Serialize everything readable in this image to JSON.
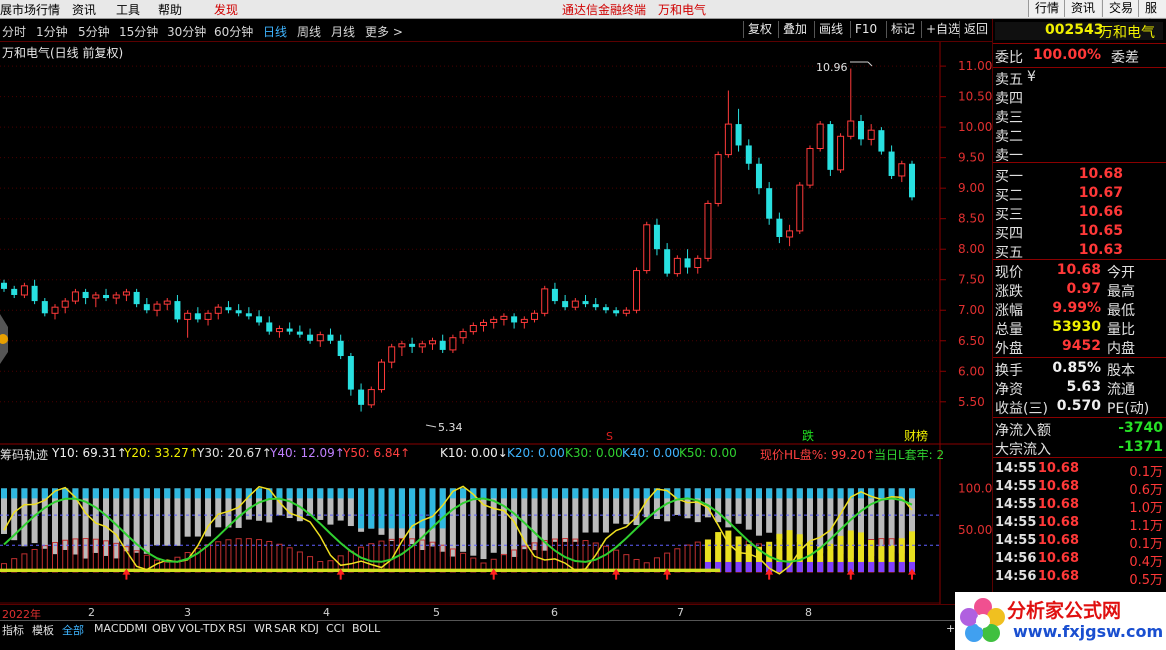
{
  "menu": {
    "items": [
      "展市场行情",
      "资讯",
      "工具",
      "帮助"
    ],
    "discover": "发现",
    "center_title": "通达信金融终端",
    "center_stock": "万和电气",
    "right_buttons": [
      "行情",
      "资讯",
      "交易",
      "服务"
    ]
  },
  "periods": [
    "分时",
    "1分钟",
    "5分钟",
    "15分钟",
    "30分钟",
    "60分钟",
    "日线",
    "周线",
    "月线",
    "更多 >"
  ],
  "active_period": "日线",
  "toolbar": [
    "复权",
    "叠加",
    "画线",
    "F10",
    "标记",
    "+自选",
    "返回"
  ],
  "stock_title": "万和电气(日线 前复权)",
  "quote": {
    "code": "002543",
    "name": "万和电气",
    "weibi_label": "委比",
    "weibi_value": "100.00%",
    "weicha_label": "委差",
    "sells": [
      {
        "label": "卖五",
        "price": "¥"
      },
      {
        "label": "卖四",
        "price": ""
      },
      {
        "label": "卖三",
        "price": ""
      },
      {
        "label": "卖二",
        "price": ""
      },
      {
        "label": "卖一",
        "price": ""
      }
    ],
    "buys": [
      {
        "label": "买一",
        "price": "10.68"
      },
      {
        "label": "买二",
        "price": "10.67"
      },
      {
        "label": "买三",
        "price": "10.66"
      },
      {
        "label": "买四",
        "price": "10.65"
      },
      {
        "label": "买五",
        "price": "10.63"
      }
    ],
    "stats": [
      {
        "l1": "现价",
        "v1": "10.68",
        "c1": "red",
        "l2": "今开"
      },
      {
        "l1": "涨跌",
        "v1": "0.97",
        "c1": "red",
        "l2": "最高"
      },
      {
        "l1": "涨幅",
        "v1": "9.99%",
        "c1": "red",
        "l2": "最低"
      },
      {
        "l1": "总量",
        "v1": "53930",
        "c1": "yellow",
        "l2": "量比"
      },
      {
        "l1": "外盘",
        "v1": "9452",
        "c1": "red",
        "l2": "内盘"
      }
    ],
    "stats2": [
      {
        "l1": "换手",
        "v1": "0.85%",
        "c1": "white",
        "l2": "股本"
      },
      {
        "l1": "净资",
        "v1": "5.63",
        "c1": "white",
        "l2": "流通"
      },
      {
        "l1": "收益(三)",
        "v1": "0.570",
        "c1": "white",
        "l2": "PE(动)"
      }
    ],
    "flows": [
      {
        "label": "净流入额",
        "value": "-3740",
        "color": "green"
      },
      {
        "label": "大宗流入",
        "value": "-1371",
        "color": "green"
      }
    ],
    "ticks": [
      {
        "time": "14:55",
        "price": "10.68",
        "vol": "0.1万"
      },
      {
        "time": "14:55",
        "price": "10.68",
        "vol": "0.6万"
      },
      {
        "time": "14:55",
        "price": "10.68",
        "vol": "1.0万"
      },
      {
        "time": "14:55",
        "price": "10.68",
        "vol": "1.1万"
      },
      {
        "time": "14:55",
        "price": "10.68",
        "vol": "0.1万"
      },
      {
        "time": "14:56",
        "price": "10.68",
        "vol": "0.4万"
      },
      {
        "time": "14:56",
        "price": "10.68",
        "vol": "0.5万"
      }
    ]
  },
  "chart": {
    "price_axis": [
      "11.00",
      "10.50",
      "10.00",
      "9.50",
      "9.00",
      "8.50",
      "8.00",
      "7.50",
      "7.00",
      "6.50",
      "6.00",
      "5.50"
    ],
    "high_label": "10.96",
    "low_label": "5.34",
    "markers": {
      "s": "S",
      "drop": "跌",
      "fin": "财榜"
    }
  },
  "indicator": {
    "name": "筹码轨迹",
    "y10": "Y10: 69.31↑",
    "y20": "Y20: 33.27↑",
    "y30": "Y30: 20.67↑",
    "y40": "Y40: 12.09↑",
    "y50": "Y50: 6.84↑",
    "k10": "K10: 0.00↓",
    "k20": "K20: 0.00",
    "k30": "K30: 0.00",
    "k40": "K40: 0.00",
    "k50": "K50: 0.00",
    "hl": "现价HL盘%: 99.20↑",
    "day": "当日L套牢: 2",
    "axis": [
      "100.0",
      "50.00"
    ]
  },
  "dates": [
    "2022年",
    "2",
    "3",
    "4",
    "5",
    "6",
    "7",
    "8"
  ],
  "tabs": [
    "指标",
    "模板",
    "全部",
    "MACD",
    "DMI",
    "OBV",
    "VOL-TDX",
    "RSI",
    "WR",
    "SAR",
    "KDJ",
    "CCI",
    "BOLL"
  ],
  "active_tab": "全部",
  "watermark": {
    "title": "分析家公式网",
    "url": "www.fxjgsw.com"
  },
  "chart_data": {
    "type": "candlestick",
    "title": "万和电气(日线 前复权)",
    "ylim": [
      5.3,
      11.1
    ],
    "ohlc": [
      [
        7.45,
        7.5,
        7.3,
        7.35
      ],
      [
        7.35,
        7.4,
        7.2,
        7.25
      ],
      [
        7.25,
        7.45,
        7.2,
        7.4
      ],
      [
        7.4,
        7.5,
        7.1,
        7.15
      ],
      [
        7.15,
        7.2,
        6.9,
        6.95
      ],
      [
        6.95,
        7.1,
        6.85,
        7.05
      ],
      [
        7.05,
        7.2,
        6.95,
        7.15
      ],
      [
        7.15,
        7.35,
        7.1,
        7.3
      ],
      [
        7.3,
        7.35,
        7.1,
        7.2
      ],
      [
        7.2,
        7.3,
        7.05,
        7.25
      ],
      [
        7.25,
        7.35,
        7.15,
        7.2
      ],
      [
        7.2,
        7.3,
        7.1,
        7.25
      ],
      [
        7.25,
        7.35,
        7.15,
        7.3
      ],
      [
        7.3,
        7.35,
        7.05,
        7.1
      ],
      [
        7.1,
        7.2,
        6.95,
        7.0
      ],
      [
        7.0,
        7.15,
        6.9,
        7.1
      ],
      [
        7.1,
        7.2,
        7.0,
        7.15
      ],
      [
        7.15,
        7.25,
        6.8,
        6.85
      ],
      [
        6.85,
        7.0,
        6.55,
        6.95
      ],
      [
        6.95,
        7.05,
        6.8,
        6.85
      ],
      [
        6.85,
        7.0,
        6.75,
        6.95
      ],
      [
        6.95,
        7.1,
        6.85,
        7.05
      ],
      [
        7.05,
        7.15,
        6.95,
        7.0
      ],
      [
        7.0,
        7.1,
        6.9,
        6.95
      ],
      [
        6.95,
        7.05,
        6.85,
        6.9
      ],
      [
        6.9,
        7.0,
        6.75,
        6.8
      ],
      [
        6.8,
        6.9,
        6.6,
        6.65
      ],
      [
        6.65,
        6.75,
        6.55,
        6.7
      ],
      [
        6.7,
        6.8,
        6.6,
        6.65
      ],
      [
        6.65,
        6.75,
        6.55,
        6.6
      ],
      [
        6.6,
        6.7,
        6.45,
        6.5
      ],
      [
        6.5,
        6.65,
        6.4,
        6.6
      ],
      [
        6.6,
        6.7,
        6.45,
        6.5
      ],
      [
        6.5,
        6.6,
        6.2,
        6.25
      ],
      [
        6.25,
        6.3,
        5.6,
        5.7
      ],
      [
        5.7,
        5.8,
        5.34,
        5.45
      ],
      [
        5.45,
        5.75,
        5.4,
        5.7
      ],
      [
        5.7,
        6.2,
        5.65,
        6.15
      ],
      [
        6.15,
        6.45,
        6.05,
        6.4
      ],
      [
        6.4,
        6.5,
        6.25,
        6.45
      ],
      [
        6.45,
        6.55,
        6.3,
        6.4
      ],
      [
        6.4,
        6.5,
        6.3,
        6.45
      ],
      [
        6.45,
        6.55,
        6.35,
        6.5
      ],
      [
        6.5,
        6.6,
        6.3,
        6.35
      ],
      [
        6.35,
        6.6,
        6.3,
        6.55
      ],
      [
        6.55,
        6.7,
        6.45,
        6.65
      ],
      [
        6.65,
        6.8,
        6.6,
        6.75
      ],
      [
        6.75,
        6.85,
        6.65,
        6.8
      ],
      [
        6.8,
        6.9,
        6.7,
        6.85
      ],
      [
        6.85,
        6.95,
        6.75,
        6.9
      ],
      [
        6.9,
        6.95,
        6.7,
        6.8
      ],
      [
        6.8,
        6.9,
        6.7,
        6.85
      ],
      [
        6.85,
        7.0,
        6.8,
        6.95
      ],
      [
        6.95,
        7.4,
        6.9,
        7.35
      ],
      [
        7.35,
        7.45,
        7.1,
        7.15
      ],
      [
        7.15,
        7.25,
        7.0,
        7.05
      ],
      [
        7.05,
        7.2,
        7.0,
        7.15
      ],
      [
        7.15,
        7.25,
        7.05,
        7.1
      ],
      [
        7.1,
        7.2,
        7.0,
        7.05
      ],
      [
        7.05,
        7.1,
        6.95,
        7.0
      ],
      [
        7.0,
        7.05,
        6.9,
        6.95
      ],
      [
        6.95,
        7.05,
        6.9,
        7.0
      ],
      [
        7.0,
        7.7,
        6.95,
        7.65
      ],
      [
        7.65,
        8.45,
        7.6,
        8.4
      ],
      [
        8.4,
        8.5,
        7.9,
        8.0
      ],
      [
        8.0,
        8.1,
        7.55,
        7.6
      ],
      [
        7.6,
        7.9,
        7.55,
        7.85
      ],
      [
        7.85,
        8.0,
        7.6,
        7.7
      ],
      [
        7.7,
        7.9,
        7.6,
        7.85
      ],
      [
        7.85,
        8.8,
        7.8,
        8.75
      ],
      [
        8.75,
        9.6,
        8.7,
        9.55
      ],
      [
        9.55,
        10.6,
        9.5,
        10.05
      ],
      [
        10.05,
        10.3,
        9.6,
        9.7
      ],
      [
        9.7,
        9.8,
        9.3,
        9.4
      ],
      [
        9.4,
        9.5,
        8.9,
        9.0
      ],
      [
        9.0,
        9.1,
        8.4,
        8.5
      ],
      [
        8.5,
        8.6,
        8.1,
        8.2
      ],
      [
        8.2,
        8.4,
        8.05,
        8.3
      ],
      [
        8.3,
        9.1,
        8.25,
        9.05
      ],
      [
        9.05,
        9.7,
        9.0,
        9.65
      ],
      [
        9.65,
        10.1,
        9.6,
        10.05
      ],
      [
        10.05,
        10.1,
        9.2,
        9.3
      ],
      [
        9.3,
        9.9,
        9.25,
        9.85
      ],
      [
        9.85,
        10.96,
        9.8,
        10.1
      ],
      [
        10.1,
        10.2,
        9.7,
        9.8
      ],
      [
        9.8,
        10.05,
        9.7,
        9.95
      ],
      [
        9.95,
        10.0,
        9.55,
        9.6
      ],
      [
        9.6,
        9.7,
        9.15,
        9.2
      ],
      [
        9.2,
        9.45,
        9.1,
        9.4
      ],
      [
        9.4,
        9.45,
        8.8,
        8.85
      ]
    ]
  }
}
